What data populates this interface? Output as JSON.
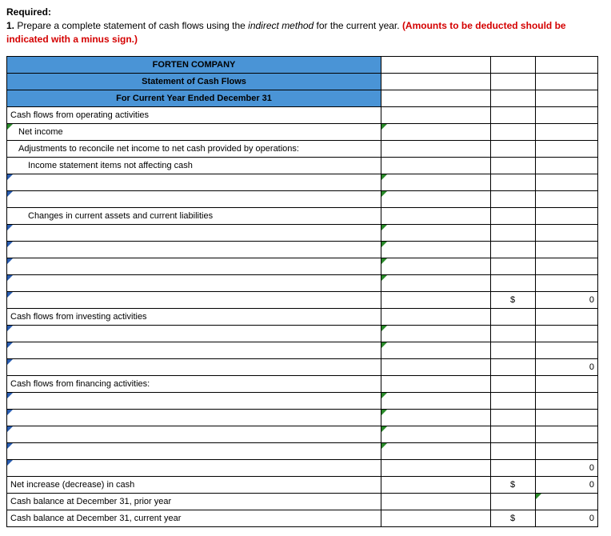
{
  "header": {
    "required": "Required:",
    "line1_num": "1.",
    "line1_a": " Prepare a complete statement of cash flows using the ",
    "line1_italic": "indirect method",
    "line1_b": " for the current year. ",
    "line1_red": "(Amounts to be deducted should be indicated with a minus sign.)"
  },
  "table": {
    "title1": "FORTEN COMPANY",
    "title2": "Statement of Cash Flows",
    "title3": "For Current Year Ended December 31",
    "r_op": "Cash flows from operating activities",
    "r_ni": "Net income",
    "r_adj": "Adjustments to reconcile net income to net cash provided by operations:",
    "r_isna": "Income statement items not affecting cash",
    "r_chg": "Changes in current assets and current liabilities",
    "r_inv": "Cash flows from investing activities",
    "r_fin": "Cash flows from financing activities:",
    "r_netinc": "Net increase (decrease) in cash",
    "r_prior": "Cash balance at December 31, prior year",
    "r_curr": "Cash balance at December 31, current year",
    "dollar": "$",
    "zero": "0"
  }
}
